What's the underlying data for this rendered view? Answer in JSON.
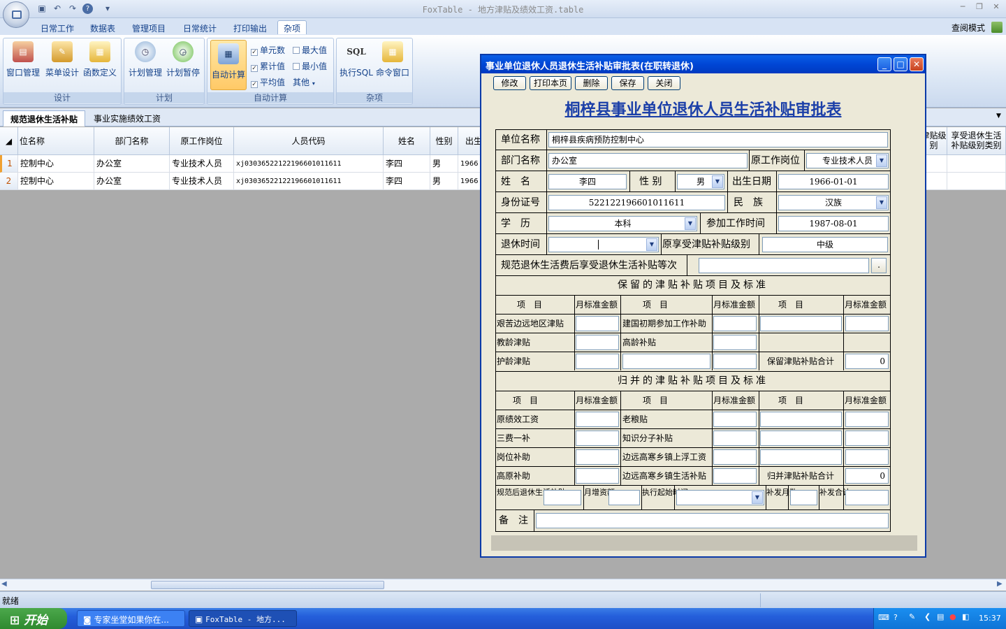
{
  "app": {
    "title": "FoxTable - 地方津贴及绩效工资.table",
    "read_mode": "查阅模式",
    "status": "就绪"
  },
  "ribbon": {
    "tabs": [
      "日常工作",
      "数据表",
      "管理项目",
      "日常统计",
      "打印输出",
      "杂项"
    ],
    "active_tab": "杂项",
    "groups": {
      "design": {
        "title": "设计",
        "buttons": [
          "窗口管理",
          "菜单设计",
          "函数定义"
        ]
      },
      "plan": {
        "title": "计划",
        "buttons": [
          "计划管理",
          "计划暂停"
        ]
      },
      "autocalc": {
        "title": "自动计算",
        "button": "自动计算",
        "checks": [
          "单元数",
          "最大值",
          "累计值",
          "最小值",
          "平均值"
        ],
        "other": "其他"
      },
      "misc": {
        "title": "杂项",
        "buttons": [
          "执行SQL",
          "命令窗口"
        ],
        "sql_icon": "SQL"
      }
    }
  },
  "doc_tabs": [
    "规范退休生活补贴",
    "事业实施绩效工资"
  ],
  "grid": {
    "headers": [
      "位名称",
      "部门名称",
      "原工作岗位",
      "人员代码",
      "姓名",
      "性别",
      "出生",
      "津贴级别",
      "享受退休生活补贴级别类别"
    ],
    "rows": [
      {
        "n": "1",
        "unit": "控制中心",
        "dept": "办公室",
        "post": "专业技术人员",
        "code": "xj030365221221966010116​11",
        "name": "李四",
        "sex": "男",
        "birth": "1966"
      },
      {
        "n": "2",
        "unit": "控制中心",
        "dept": "办公室",
        "post": "专业技术人员",
        "code": "xj030365221221966010116​11",
        "name": "李四",
        "sex": "男",
        "birth": "1966"
      }
    ]
  },
  "dialog": {
    "title": "事业单位退休人员退休生活补贴审批表(在职转退休)",
    "buttons": [
      "修改",
      "打印本页",
      "删除",
      "保存",
      "关闭"
    ],
    "form_title": "桐梓县事业单位退休人员生活补贴审批表",
    "labels": {
      "unit": "单位名称",
      "dept": "部门名称",
      "post": "原工作岗位",
      "name": "姓　名",
      "sex": "性 别",
      "birth": "出生日期",
      "id": "身份证号",
      "ethnic": "民　族",
      "edu": "学　历",
      "work_start": "参加工作时间",
      "retire": "退休时间",
      "orig_level": "原享受津贴补贴级别",
      "grade": "规范退休生活费后享受退休生活补贴等次",
      "sec1": "保留的津贴补贴项目及标准",
      "sec2": "归并的津贴补贴项目及标准",
      "item": "项　目",
      "std": "月标准金额",
      "after": "规范后退休生活补贴",
      "monthly_inc": "月增资额",
      "exec_start": "执行起始时间",
      "back_months": "补发月数",
      "back_total": "补发合计",
      "remark": "备　注"
    },
    "values": {
      "unit": "桐梓县疾病预防控制中心",
      "dept": "办公室",
      "post": "专业技术人员",
      "name": "李四",
      "sex": "男",
      "birth": "1966-01-01",
      "id": "522122196601011611",
      "ethnic": "汉族",
      "edu": "本科",
      "work_start": "1987-08-01",
      "orig_level": "中级"
    },
    "sec1_items": [
      "艰苦边远地区津贴",
      "建国初期参加工作补助",
      "教龄津贴",
      "高龄补贴",
      "护龄津贴"
    ],
    "sec1_total_label": "保留津贴补贴合计",
    "sec1_total": "0",
    "sec2_items": [
      "原绩效工资",
      "老粮贴",
      "三费一补",
      "知识分子补贴",
      "岗位补助",
      "边远高寒乡镇上浮工资",
      "高原补助",
      "边远高寒乡镇生活补贴"
    ],
    "sec2_total_label": "归并津贴补贴合计",
    "sec2_total": "0",
    "browse": "."
  },
  "taskbar": {
    "start": "开始",
    "tasks": [
      "专家坐堂如果你在...",
      "FoxTable - 地方..."
    ],
    "time": "15:37"
  },
  "colors": {
    "ribbon_text": "#15428b",
    "dialog_title": "#0046d5",
    "form_title": "#1b3fa8",
    "row_number": "#c05000"
  }
}
